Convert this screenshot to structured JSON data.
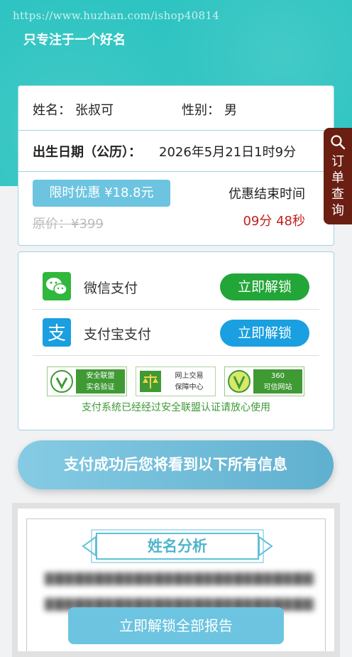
{
  "header": {
    "watermark": "https://www.huzhan.com/ishop40814",
    "tagline": "只专注于一个好名"
  },
  "info": {
    "name_label": "姓名：",
    "name_value": "张叔可",
    "gender_label": "性别：",
    "gender_value": "男",
    "birth_label": "出生日期（公历）：",
    "birth_value": "2026年5月21日1时9分",
    "promo_label": "限时优惠 ¥18.8元",
    "original_price": "原价：¥399",
    "end_label": "优惠结束时间",
    "countdown": "09分 48秒"
  },
  "side_tab": {
    "icon": "search-icon",
    "label": "订\n单\n查\n询"
  },
  "payment": {
    "wechat_label": "微信支付",
    "wechat_button": "立即解锁",
    "alipay_label": "支付宝支付",
    "alipay_button": "立即解锁",
    "badges": [
      {
        "icon": "v-check-icon",
        "text": "安全联盟\n实名验证"
      },
      {
        "icon": "scales-icon",
        "text": "网上交易\n保障中心"
      },
      {
        "icon": "v-icon",
        "text": "360\n可信网站"
      }
    ],
    "security_note": "支付系统已经经过安全联盟认证请放心使用"
  },
  "after_pay_banner": "支付成功后您将看到以下所有信息",
  "report": {
    "section_title": "姓名分析",
    "unlock_all_button": "立即解锁全部报告"
  },
  "colors": {
    "hero": "#2ec4c1",
    "accent_blue": "#6cc4e0",
    "wechat_green": "#23a638",
    "alipay_blue": "#1a9fe0",
    "countdown_red": "#c41e1e",
    "side_tab": "#6a1f12"
  }
}
